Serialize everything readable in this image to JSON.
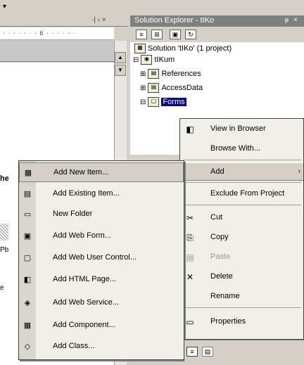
{
  "left_pane": {
    "top_arrow": "▾",
    "tab_controls": "·| › ×",
    "ruler_text": "· · · · · · · 6 · · · · · ·",
    "frag_1": "he",
    "frag_2": "Pb",
    "frag_3": "e"
  },
  "solution_explorer": {
    "title": "Solution Explorer - tIKo",
    "pin_icon": "pin-icon",
    "pin_glyph": "ᵽ",
    "close_glyph": "×",
    "toolbar_icons": [
      "≡",
      "⊞",
      "▣",
      "↻"
    ],
    "tree": [
      {
        "label": "Solution 'tIKo' (1 project)",
        "icon": "▦"
      },
      {
        "label": "tIKum",
        "icon": "◉",
        "expander": "⊟"
      },
      {
        "label": "References",
        "icon": "▤",
        "expander": "⊞"
      },
      {
        "label": "AccessData",
        "icon": "▤",
        "expander": "⊞"
      },
      {
        "label": "Forms",
        "icon": "▢",
        "expander": "⊟"
      }
    ]
  },
  "context_menu": {
    "items": [
      {
        "label": "View in Browser",
        "icon": "◧"
      },
      {
        "label": "Browse With...",
        "icon": ""
      },
      {
        "label": "Add",
        "icon": "",
        "arrow": "›"
      },
      {
        "label": "Exclude From Project",
        "icon": ""
      },
      {
        "label": "Cut",
        "icon": "✂"
      },
      {
        "label": "Copy",
        "icon": "⎘"
      },
      {
        "label": "Paste",
        "icon": "▤"
      },
      {
        "label": "Delete",
        "icon": "✕"
      },
      {
        "label": "Rename",
        "icon": ""
      },
      {
        "label": "Properties",
        "icon": "▭"
      }
    ]
  },
  "add_submenu": {
    "items": [
      {
        "label": "Add New Item...",
        "icon": "▦"
      },
      {
        "label": "Add Existing Item...",
        "icon": "▤"
      },
      {
        "label": "New Folder",
        "icon": "▭"
      },
      {
        "label": "Add Web Form...",
        "icon": "▣"
      },
      {
        "label": "Add Web User Control...",
        "icon": "▢"
      },
      {
        "label": "Add HTML Page...",
        "icon": "◧"
      },
      {
        "label": "Add Web Service...",
        "icon": "◈"
      },
      {
        "label": "Add Component...",
        "icon": "▦"
      },
      {
        "label": "Add Class...",
        "icon": "◇"
      }
    ]
  },
  "bottom": {
    "icon_1": "≡",
    "icon_2": "▤"
  },
  "colors": {
    "selection": "#000080",
    "menu_bg": "#f0efe8",
    "chrome": "#d4d0c8"
  }
}
